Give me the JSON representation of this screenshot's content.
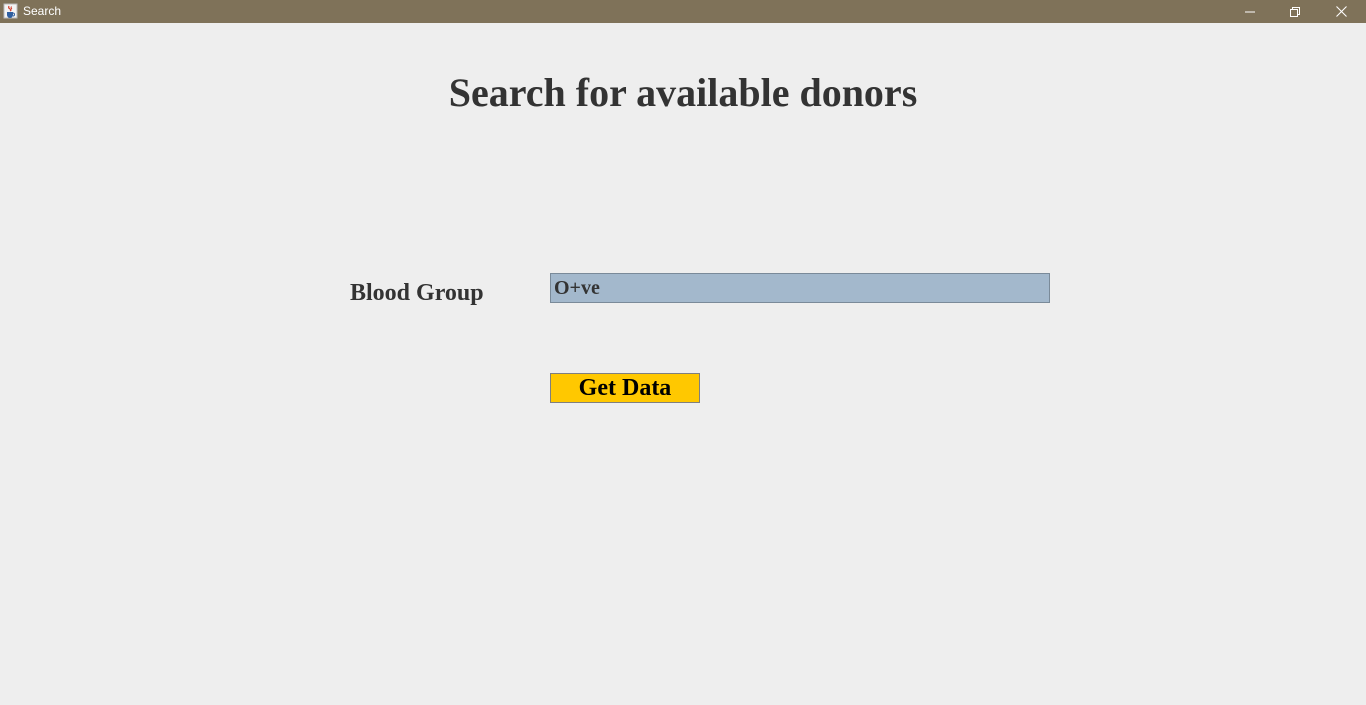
{
  "window": {
    "title": "Search",
    "app_icon": "java-cup-icon",
    "controls": [
      "minimize-icon",
      "maximize-icon",
      "close-icon"
    ]
  },
  "form": {
    "heading": "Search for available donors",
    "blood_group_label": "Blood Group",
    "blood_group_value": "O+ve",
    "get_data_label": "Get Data"
  },
  "colors": {
    "titlebar": "#7f7259",
    "background": "#eeeeee",
    "field_background": "#a3b8cc",
    "button_background": "#ffc800",
    "text": "#333333"
  }
}
